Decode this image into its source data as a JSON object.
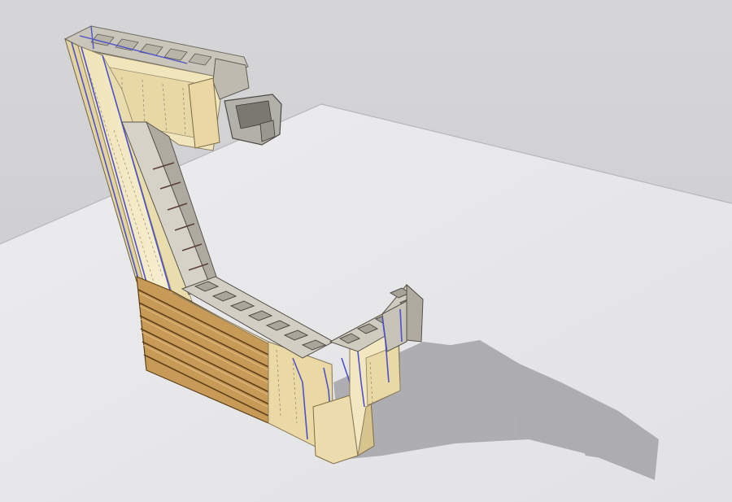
{
  "scene": {
    "sky_color": "#cfcfd1",
    "ground_color": "#e6e6e8",
    "shadow_color": "#a9a9ad",
    "block_light": "#d9d6cc",
    "block_mid": "#bdb9ae",
    "block_dark": "#8e8a80",
    "insulation_color": "#f3e9c4",
    "insulation_shade": "#e5d7a8",
    "membrane_color": "#5a5cc8",
    "siding_color": "#c99b58",
    "siding_line": "#6e4c22",
    "wood_color": "#e9d6a4"
  }
}
